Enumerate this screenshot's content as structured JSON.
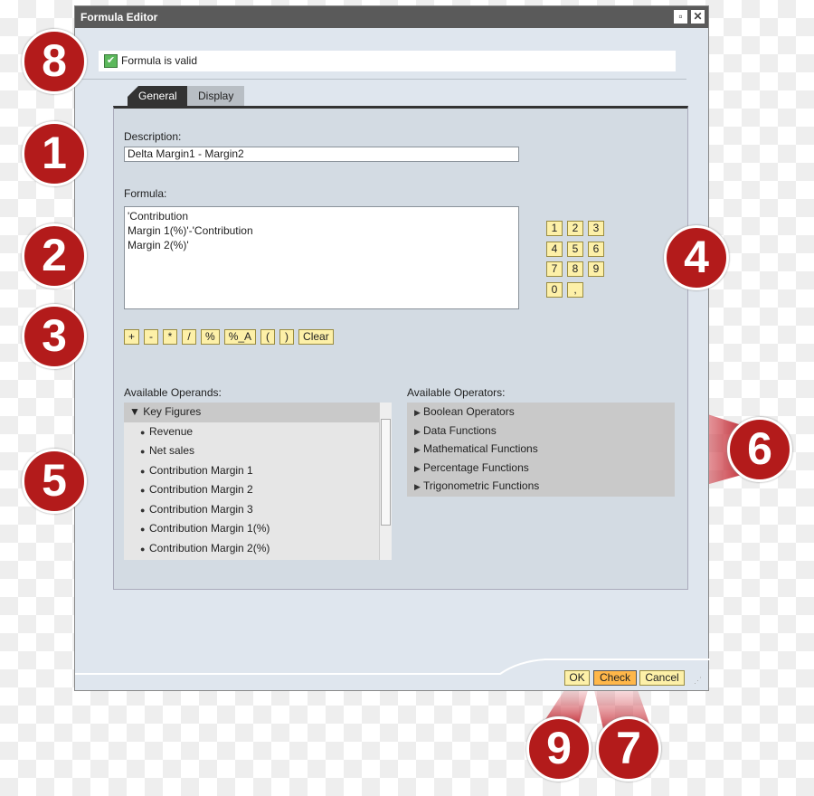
{
  "window": {
    "title": "Formula Editor",
    "maximize_icon": "maximize-icon",
    "close_icon": "close-icon"
  },
  "status": {
    "text": "Formula is valid",
    "icon": "check-icon",
    "color": "#5cb85c"
  },
  "tabs": [
    {
      "label": "General",
      "active": true
    },
    {
      "label": "Display",
      "active": false
    }
  ],
  "general": {
    "description_label": "Description:",
    "description_value": "Delta Margin1 - Margin2",
    "formula_label": "Formula:",
    "formula_value": "'Contribution\nMargin 1(%)'-'Contribution\nMargin 2(%)'",
    "keypad": [
      "1",
      "2",
      "3",
      "4",
      "5",
      "6",
      "7",
      "8",
      "9",
      "0",
      ","
    ],
    "operator_buttons": [
      "+",
      "-",
      "*",
      "/",
      "%",
      "%_A",
      "(",
      ")",
      "Clear"
    ],
    "operands_label": "Available Operands:",
    "operands": {
      "group": "Key Figures",
      "items": [
        "Revenue",
        "Net sales",
        "Contribution Margin 1",
        "Contribution Margin 2",
        "Contribution Margin 3",
        "Contribution Margin 1(%)",
        "Contribution Margin 2(%)"
      ]
    },
    "operators_label": "Available Operators:",
    "operators": [
      "Boolean Operators",
      "Data Functions",
      "Mathematical Functions",
      "Percentage Functions",
      "Trigonometric Functions"
    ]
  },
  "footer": {
    "ok": "OK",
    "check": "Check",
    "cancel": "Cancel"
  },
  "callouts": [
    "8",
    "1",
    "2",
    "3",
    "4",
    "5",
    "6",
    "9",
    "7"
  ],
  "colors": {
    "callout": "#b31b1b",
    "button": "#fdf0a8",
    "button_active": "#ffb74a",
    "titlebar": "#5a5a5a"
  }
}
